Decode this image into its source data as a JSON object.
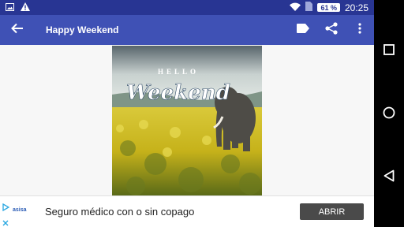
{
  "status_bar": {
    "battery": "61 %",
    "time": "20:25",
    "icons": [
      "image-notification-icon",
      "warning-icon",
      "wifi-icon",
      "sim-icon",
      "battery-icon"
    ]
  },
  "app_bar": {
    "title": "Happy Weekend",
    "actions": [
      "label-icon",
      "share-icon",
      "more-vert-icon"
    ]
  },
  "photo": {
    "text_top": "HELLO",
    "text_main": "Weekend"
  },
  "ad": {
    "brand": "asisa",
    "text": "Seguro médico con o sin copago",
    "button": "ABRIR"
  },
  "colors": {
    "status_bar": "#283593",
    "app_bar": "#3f51b5"
  }
}
